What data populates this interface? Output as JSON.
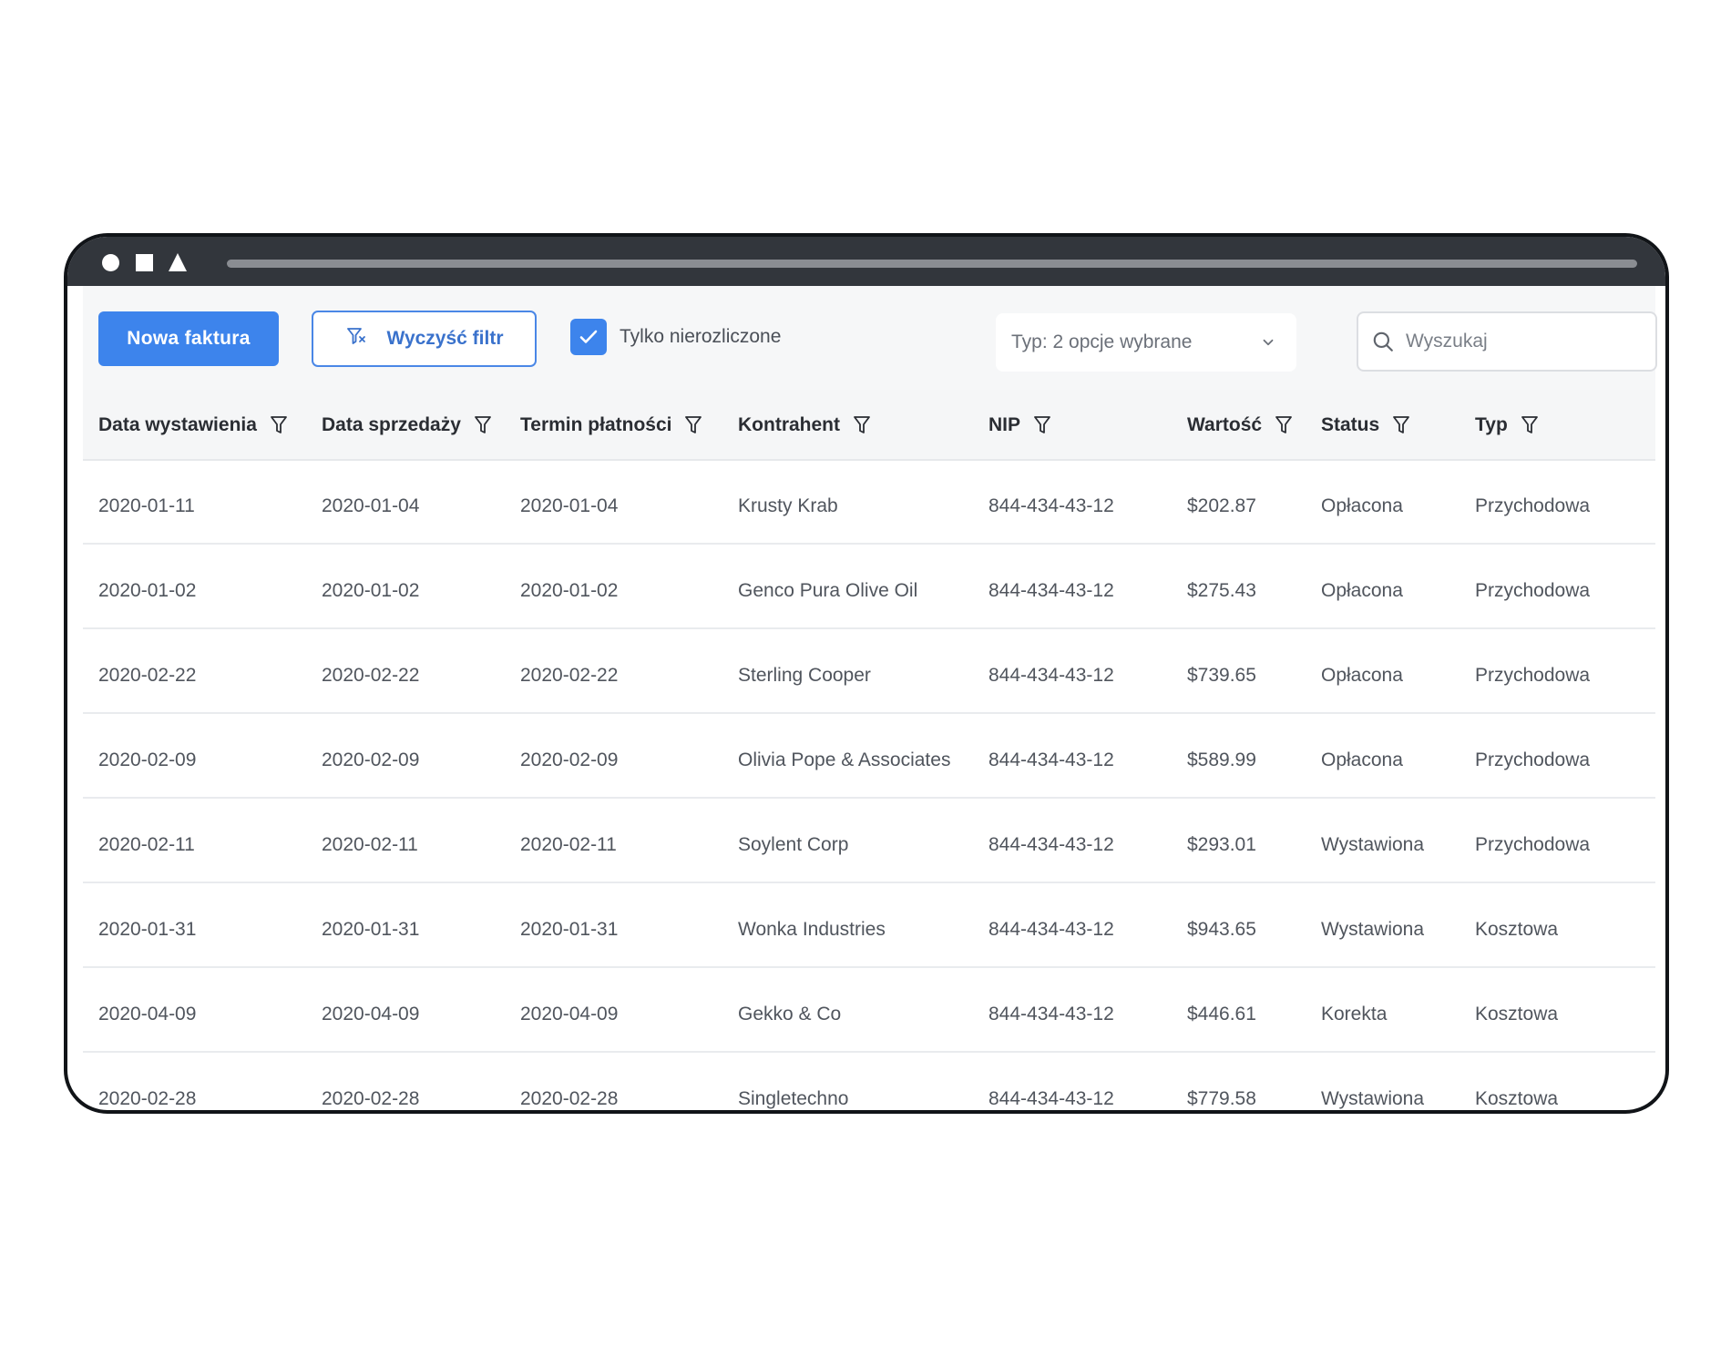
{
  "toolbar": {
    "new_invoice_label": "Nowa faktura",
    "clear_filter_label": "Wyczyść filtr",
    "only_unsettled_label": "Tylko nierozliczone",
    "only_unsettled_checked": true,
    "type_select_value": "Typ: 2 opcje wybrane",
    "search_placeholder": "Wyszukaj"
  },
  "table": {
    "columns": [
      "Data wystawienia",
      "Data sprzedaży",
      "Termin płatności",
      "Kontrahent",
      "NIP",
      "Wartość",
      "Status",
      "Typ"
    ],
    "rows": [
      [
        "2020-01-11",
        "2020-01-04",
        "2020-01-04",
        "Krusty Krab",
        "844-434-43-12",
        "$202.87",
        "Opłacona",
        "Przychodowa"
      ],
      [
        "2020-01-02",
        "2020-01-02",
        "2020-01-02",
        "Genco Pura Olive Oil",
        "844-434-43-12",
        "$275.43",
        "Opłacona",
        "Przychodowa"
      ],
      [
        "2020-02-22",
        "2020-02-22",
        "2020-02-22",
        "Sterling Cooper",
        "844-434-43-12",
        "$739.65",
        "Opłacona",
        "Przychodowa"
      ],
      [
        "2020-02-09",
        "2020-02-09",
        "2020-02-09",
        "Olivia Pope & Associates",
        "844-434-43-12",
        "$589.99",
        "Opłacona",
        "Przychodowa"
      ],
      [
        "2020-02-11",
        "2020-02-11",
        "2020-02-11",
        "Soylent Corp",
        "844-434-43-12",
        "$293.01",
        "Wystawiona",
        "Przychodowa"
      ],
      [
        "2020-01-31",
        "2020-01-31",
        "2020-01-31",
        "Wonka Industries",
        "844-434-43-12",
        "$943.65",
        "Wystawiona",
        "Kosztowa"
      ],
      [
        "2020-04-09",
        "2020-04-09",
        "2020-04-09",
        "Gekko & Co",
        "844-434-43-12",
        "$446.61",
        "Korekta",
        "Kosztowa"
      ],
      [
        "2020-02-28",
        "2020-02-28",
        "2020-02-28",
        "Singletechno",
        "844-434-43-12",
        "$779.58",
        "Wystawiona",
        "Kosztowa"
      ]
    ]
  },
  "colors": {
    "accent": "#3d84ec",
    "titlebar": "#32363c",
    "header_bg": "#f5f6f7"
  },
  "icons": {
    "filter": "filter-icon",
    "clear_filter": "clear-filter-icon",
    "check": "check-icon",
    "chevron": "chevron-down-icon",
    "search": "search-icon"
  }
}
